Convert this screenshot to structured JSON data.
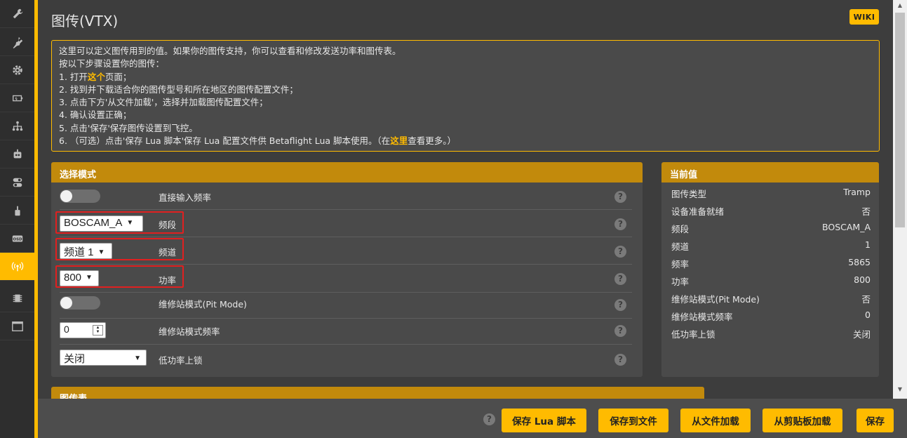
{
  "sidebar": {
    "items": [
      {
        "icon": "wrench-icon"
      },
      {
        "icon": "power-plug-icon"
      },
      {
        "icon": "gear-icon"
      },
      {
        "icon": "battery-icon"
      },
      {
        "icon": "network-icon"
      },
      {
        "icon": "robot-icon"
      },
      {
        "icon": "toggles-icon"
      },
      {
        "icon": "motor-icon"
      },
      {
        "icon": "osd-icon",
        "text": "OSD"
      },
      {
        "icon": "antenna-icon",
        "active": true
      },
      {
        "icon": "chip-icon"
      },
      {
        "icon": "window-icon"
      }
    ]
  },
  "header": {
    "title": "图传(VTX)",
    "wiki_label": "WIKI"
  },
  "note": {
    "line1": "这里可以定义图传用到的值。如果你的图传支持，你可以查看和修改发送功率和图传表。",
    "line2": "按以下步骤设置你的图传：",
    "line3_pre": "1. 打开",
    "line3_link": "这个",
    "line3_post": "页面；",
    "line4": "2. 找到并下载适合你的图传型号和所在地区的图传配置文件；",
    "line5": "3. 点击下方'从文件加载'，选择并加载图传配置文件；",
    "line6": "4. 确认设置正确；",
    "line7": "5. 点击'保存'保存图传设置到飞控。",
    "line8_pre": "6. （可选）点击'保存 Lua 脚本'保存 Lua 配置文件供 Betaflight Lua 脚本使用。（在",
    "line8_link": "这里",
    "line8_post": "查看更多。）"
  },
  "mode_panel": {
    "title": "选择模式",
    "rows": [
      {
        "label": "直接输入频率",
        "control": "toggle",
        "value": "off"
      },
      {
        "label": "频段",
        "control": "select",
        "value": "BOSCAM_A"
      },
      {
        "label": "频道",
        "control": "select",
        "value": "频道 1"
      },
      {
        "label": "功率",
        "control": "select",
        "value": "800"
      },
      {
        "label": "维修站模式(Pit Mode)",
        "control": "toggle",
        "value": "off"
      },
      {
        "label": "维修站模式频率",
        "control": "number",
        "value": "0"
      },
      {
        "label": "低功率上锁",
        "control": "select",
        "value": "关闭"
      }
    ],
    "help_glyph": "?"
  },
  "current_panel": {
    "title": "当前值",
    "items": [
      {
        "key": "图传类型",
        "value": "Tramp"
      },
      {
        "key": "设备准备就绪",
        "value": "否"
      },
      {
        "key": "频段",
        "value": "BOSCAM_A"
      },
      {
        "key": "频道",
        "value": "1"
      },
      {
        "key": "频率",
        "value": "5865"
      },
      {
        "key": "功率",
        "value": "800"
      },
      {
        "key": "维修站模式(Pit Mode)",
        "value": "否"
      },
      {
        "key": "维修站模式频率",
        "value": "0"
      },
      {
        "key": "低功率上锁",
        "value": "关闭"
      }
    ]
  },
  "vtx_table_panel": {
    "title": "图传表"
  },
  "footer": {
    "help_glyph": "?",
    "buttons": [
      {
        "label": "保存 Lua 脚本"
      },
      {
        "label": "保存到文件"
      },
      {
        "label": "从文件加载"
      },
      {
        "label": "从剪贴板加载"
      },
      {
        "label": "保存"
      }
    ]
  },
  "colors": {
    "accent": "#ffbb00",
    "panel_header": "#c28a0c",
    "highlight_box": "#e02020",
    "background": "#3d3d3d"
  }
}
